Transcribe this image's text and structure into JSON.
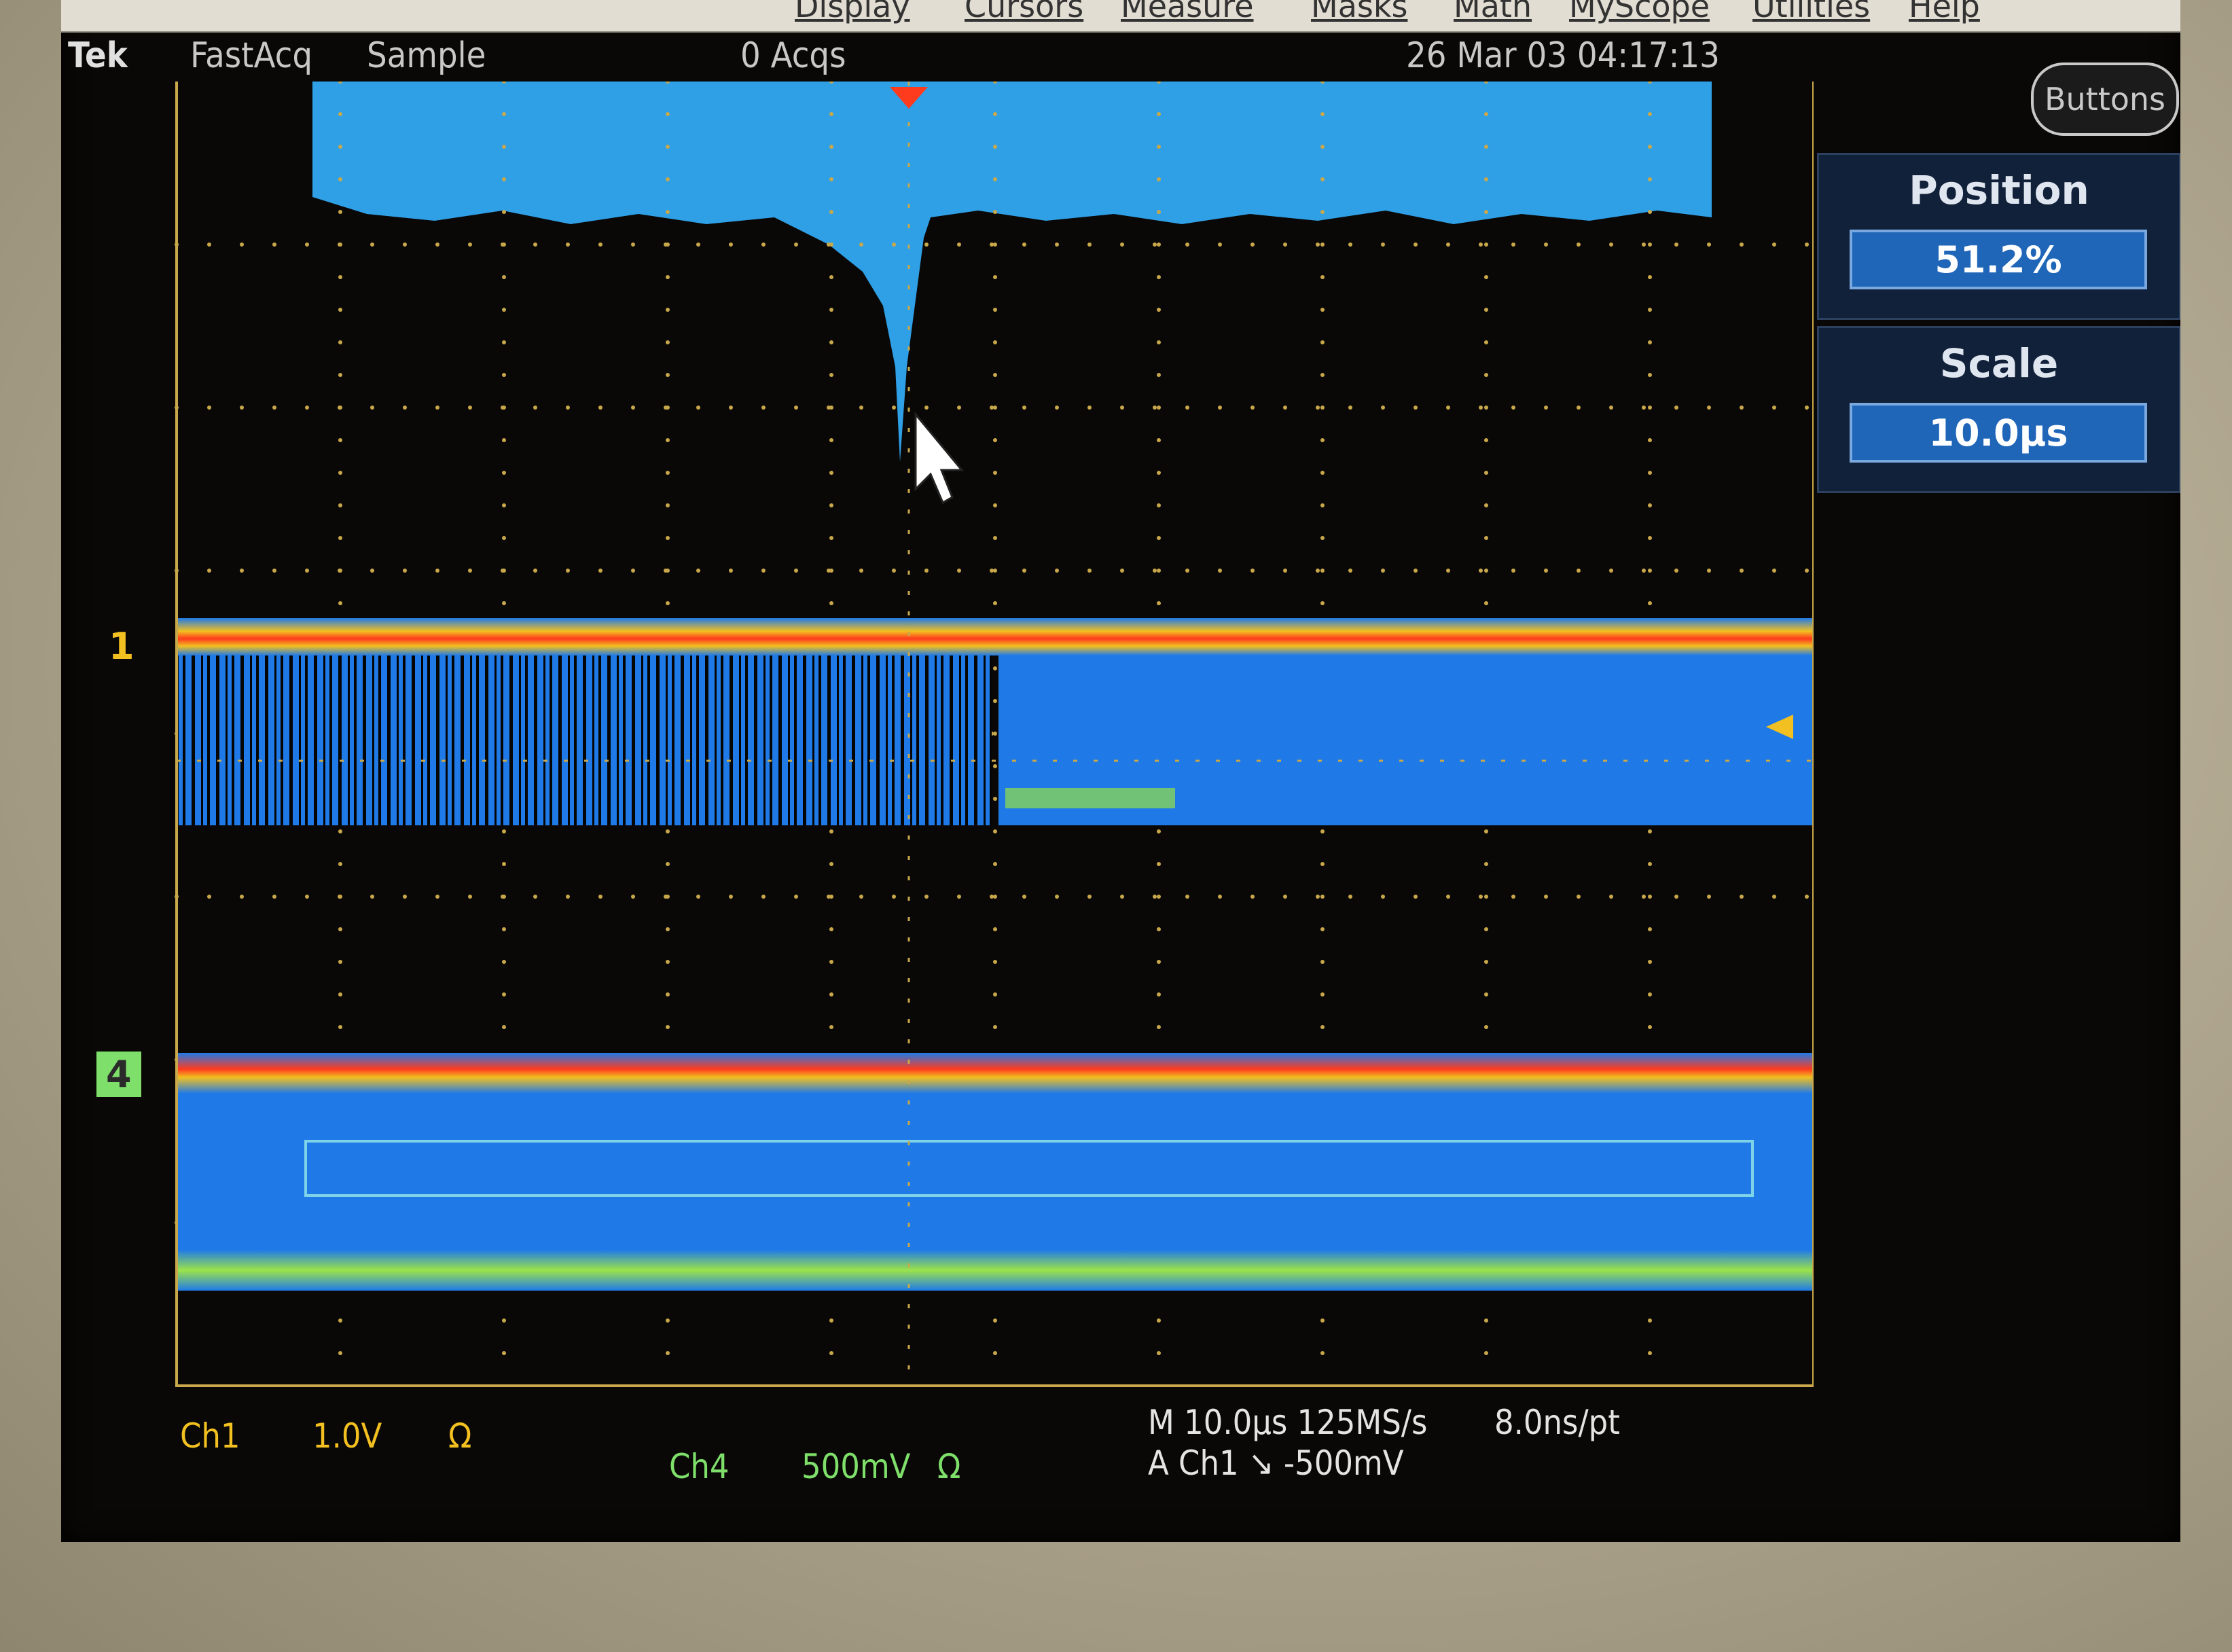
{
  "menu": [
    "Display",
    "Cursors",
    "Measure",
    "Masks",
    "Math",
    "MyScope",
    "Utilities",
    "Help"
  ],
  "status": {
    "brand": "Tek",
    "mode": "FastAcq",
    "acq_type": "Sample",
    "acqs": "0 Acqs",
    "datetime": "26 Mar 03 04:17:13"
  },
  "side_panel": {
    "buttons_label": "Buttons",
    "position_label": "Position",
    "position_value": "51.2%",
    "scale_label": "Scale",
    "scale_value": "10.0µs"
  },
  "channels": {
    "ch1_marker": "1",
    "ch4_marker": "4",
    "ch1_label": "Ch1",
    "ch1_scale": "1.0V",
    "ch1_coupling": "Ω",
    "ch4_label": "Ch4",
    "ch4_scale": "500mV",
    "ch4_coupling": "Ω"
  },
  "timebase": {
    "horizontal": "M 10.0µs 125MS/s",
    "resolution": "8.0ns/pt",
    "trigger": "A Ch1 ↘ -500mV"
  },
  "colors": {
    "trace_blue": "#1f7ae8",
    "trace_red": "#ff3b1e",
    "trace_yellow": "#f2c020",
    "ch4_green": "#7ee06a",
    "grid": "#c8a84a"
  }
}
